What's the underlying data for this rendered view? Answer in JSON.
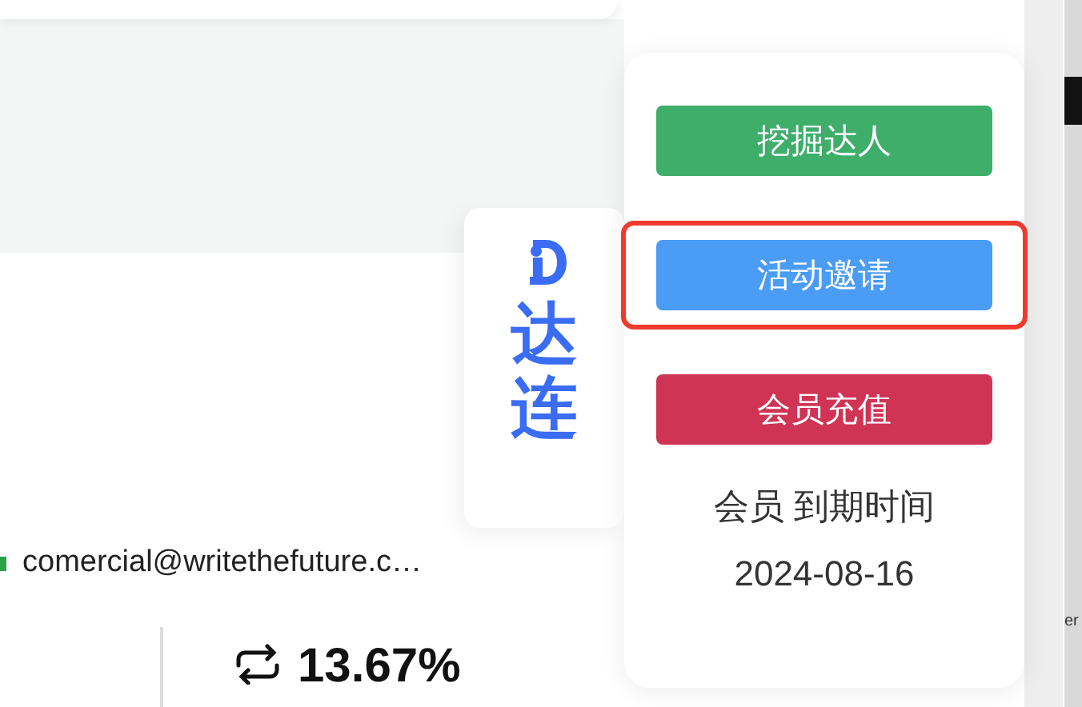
{
  "contact": {
    "email": "comercial@writethefuture.c…"
  },
  "stats": [
    {
      "value": "13.67%"
    }
  ],
  "brand_tab": {
    "name": "达连"
  },
  "side_panel": {
    "buttons": [
      {
        "label": "挖掘达人",
        "color": "#3fae6b",
        "highlighted": false
      },
      {
        "label": "活动邀请",
        "color": "#4a9cf5",
        "highlighted": true
      },
      {
        "label": "会员充值",
        "color": "#d03454",
        "highlighted": false
      }
    ],
    "membership_label": "会员 到期时间",
    "expiry_date": "2024-08-16"
  },
  "devtools_edge": {
    "text": "er"
  }
}
